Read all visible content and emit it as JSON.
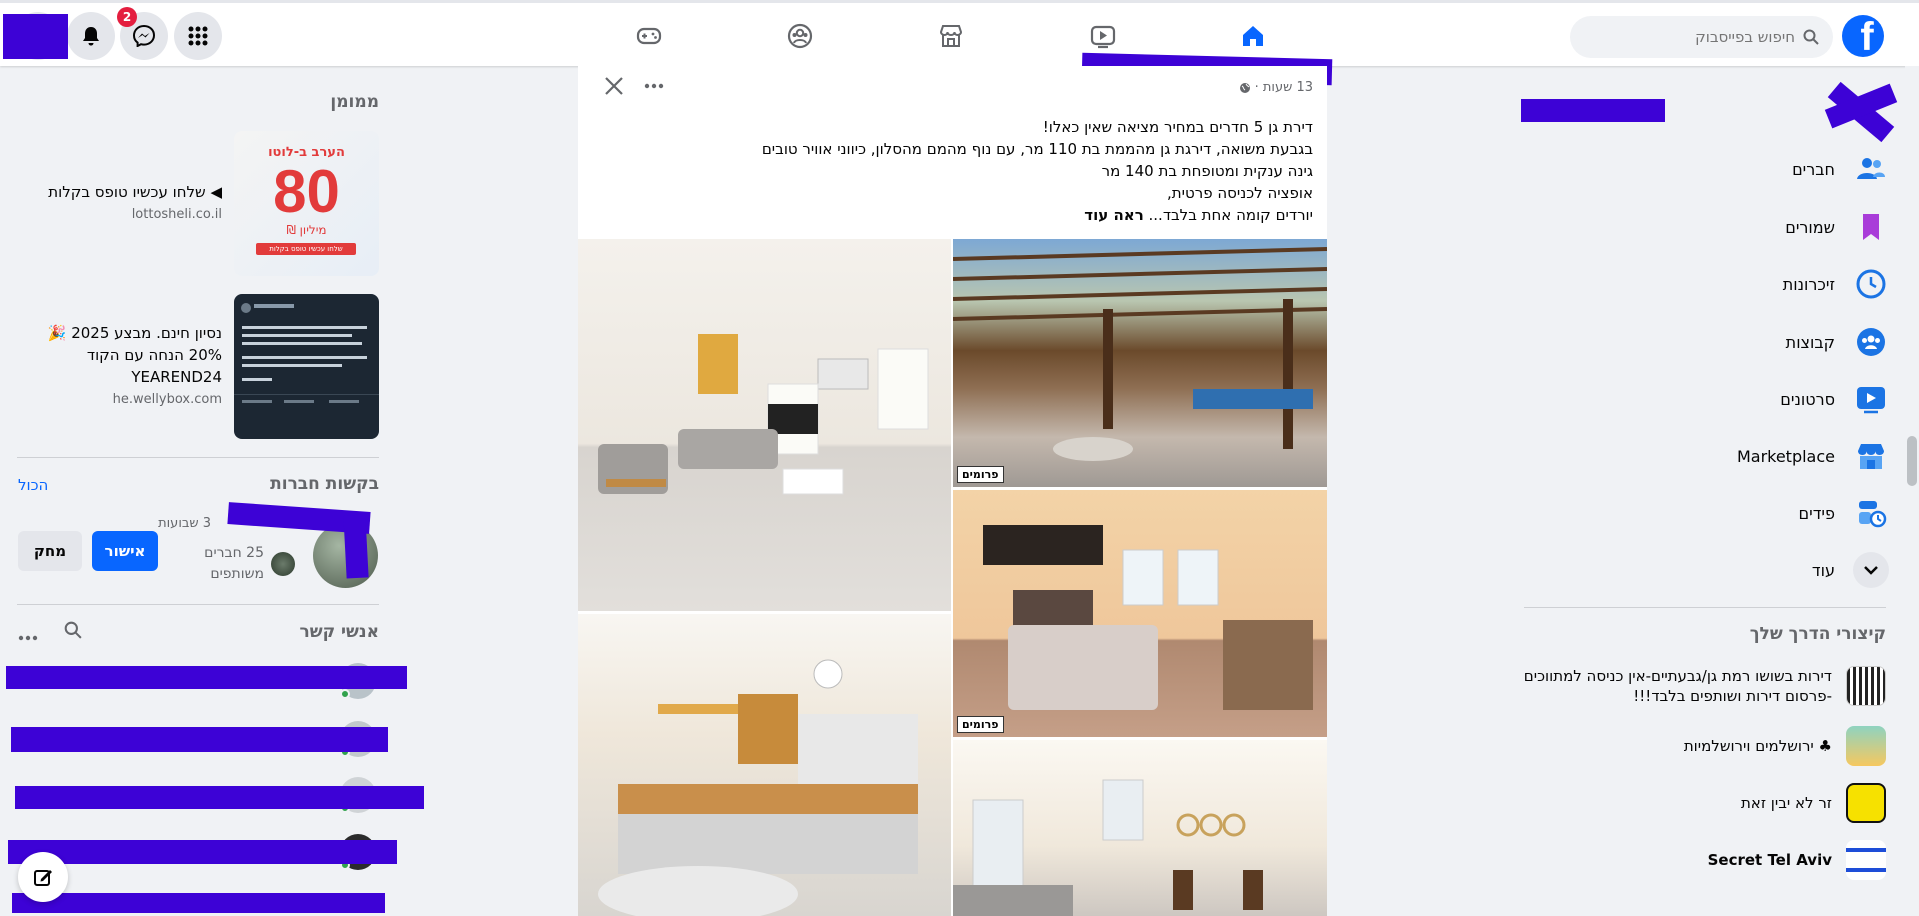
{
  "header": {
    "search_placeholder": "חיפוש בפייסבוק",
    "notification_count": "2",
    "logo_letter": "f"
  },
  "nav": {
    "tabs": [
      {
        "name": "home",
        "icon": "home-icon",
        "active": true
      },
      {
        "name": "watch",
        "icon": "video-icon",
        "active": false
      },
      {
        "name": "marketplace",
        "icon": "store-icon",
        "active": false
      },
      {
        "name": "groups",
        "icon": "groups-icon",
        "active": false
      },
      {
        "name": "gaming",
        "icon": "gamepad-icon",
        "active": false
      }
    ]
  },
  "sidebar": {
    "items": [
      {
        "label": "חברים",
        "icon": "friends-icon"
      },
      {
        "label": "שמורים",
        "icon": "bookmark-icon"
      },
      {
        "label": "זיכרונות",
        "icon": "clock-icon"
      },
      {
        "label": "קבוצות",
        "icon": "groups-icon"
      },
      {
        "label": "סרטונים",
        "icon": "video-icon"
      },
      {
        "label": "Marketplace",
        "icon": "store-icon"
      },
      {
        "label": "פידים",
        "icon": "feeds-icon"
      },
      {
        "label": "עוד",
        "icon": "chevron-down-icon"
      }
    ],
    "shortcuts_title": "קיצורי הדרך שלך",
    "shortcuts": [
      {
        "label": "דירות בשושו רמת גן/גבעתיים-אין כניסה למתווכים -פרסום דירות ושותפים בלבד!!!"
      },
      {
        "label": "♣ ירושלמים וירושלמיות"
      },
      {
        "label": "זר לא יבין זאת"
      },
      {
        "label": "Secret Tel Aviv"
      }
    ]
  },
  "post": {
    "time": "13 שעות ·",
    "lines": [
      "דירת גן 5 חדרים במחיר מציאה שאין כאלו!",
      "בגבעת משואה, דירגת גן מהממת בת 110 מר, עם נוף מהמם מהסלון, כיווני אוויר טובים",
      "גינה ענקית ומטופחת בת 140 מר",
      "אופציה לכניסה פרטית,",
      "יורדים קומה אחת בלבד..."
    ],
    "see_more": "ראה עוד",
    "photo_tag": "פרומים"
  },
  "sponsored": {
    "title": "ממומן",
    "ads": [
      {
        "title": "◀ שלחו עכשיו טופס בקלות",
        "url": "lottosheli.co.il",
        "img_top": "הערב ב-לוטו",
        "img_big": "80",
        "img_bottom": "מיליון ₪",
        "img_button": "שלחו עכשיו טופס בקלות"
      },
      {
        "title": "נסיון חינם. מבצע 2025 🎉 20% הנחה עם הקוד YEAREND24",
        "url": "he.wellybox.com"
      }
    ]
  },
  "friend_requests": {
    "title": "בקשות חברות",
    "see_all": "הכול",
    "time": "3 שבועות",
    "mutual": "25 חברים משותפים",
    "confirm": "אישור",
    "delete": "מחק"
  },
  "contacts": {
    "title": "אנשי קשר"
  }
}
